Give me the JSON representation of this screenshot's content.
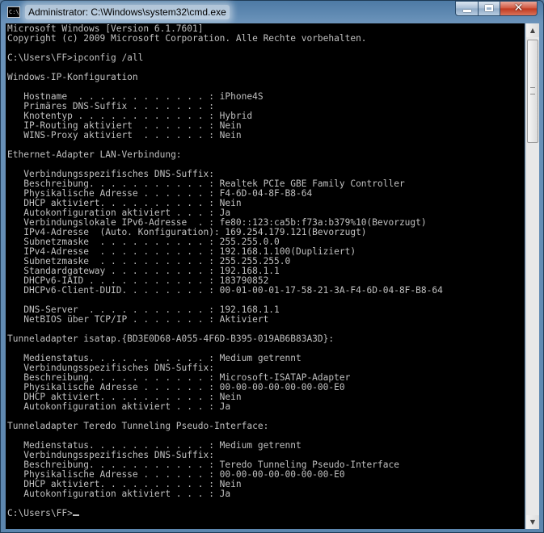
{
  "window": {
    "title": "Administrator: C:\\Windows\\system32\\cmd.exe",
    "icon": "cmd-icon",
    "icon_text": "C:\\",
    "controls": {
      "minimize": "minimize-icon",
      "maximize": "maximize-icon",
      "close": "✕"
    }
  },
  "console": {
    "text_color": "#c0c0c0",
    "background": "#000000",
    "lines": [
      "Microsoft Windows [Version 6.1.7601]",
      "Copyright (c) 2009 Microsoft Corporation. Alle Rechte vorbehalten.",
      "",
      "C:\\Users\\FF>ipconfig /all",
      "",
      "Windows-IP-Konfiguration",
      "",
      "   Hostname  . . . . . . . . . . . . : iPhone4S",
      "   Primäres DNS-Suffix . . . . . . . :",
      "   Knotentyp . . . . . . . . . . . . : Hybrid",
      "   IP-Routing aktiviert  . . . . . . : Nein",
      "   WINS-Proxy aktiviert  . . . . . . : Nein",
      "",
      "Ethernet-Adapter LAN-Verbindung:",
      "",
      "   Verbindungsspezifisches DNS-Suffix:",
      "   Beschreibung. . . . . . . . . . . : Realtek PCIe GBE Family Controller",
      "   Physikalische Adresse . . . . . . : F4-6D-04-8F-B8-64",
      "   DHCP aktiviert. . . . . . . . . . : Nein",
      "   Autokonfiguration aktiviert . . . : Ja",
      "   Verbindungslokale IPv6-Adresse  . : fe80::123:ca5b:f73a:b379%10(Bevorzugt)",
      "   IPv4-Adresse  (Auto. Konfiguration): 169.254.179.121(Bevorzugt)",
      "   Subnetzmaske  . . . . . . . . . . : 255.255.0.0",
      "   IPv4-Adresse  . . . . . . . . . . : 192.168.1.100(Dupliziert)",
      "   Subnetzmaske  . . . . . . . . . . : 255.255.255.0",
      "   Standardgateway . . . . . . . . . : 192.168.1.1",
      "   DHCPv6-IAID . . . . . . . . . . . : 183790852",
      "   DHCPv6-Client-DUID. . . . . . . . : 00-01-00-01-17-58-21-3A-F4-6D-04-8F-B8-64",
      "",
      "   DNS-Server  . . . . . . . . . . . : 192.168.1.1",
      "   NetBIOS über TCP/IP . . . . . . . : Aktiviert",
      "",
      "Tunneladapter isatap.{BD3E0D68-A055-4F6D-B395-019AB6B83A3D}:",
      "",
      "   Medienstatus. . . . . . . . . . . : Medium getrennt",
      "   Verbindungsspezifisches DNS-Suffix:",
      "   Beschreibung. . . . . . . . . . . : Microsoft-ISATAP-Adapter",
      "   Physikalische Adresse . . . . . . : 00-00-00-00-00-00-00-E0",
      "   DHCP aktiviert. . . . . . . . . . : Nein",
      "   Autokonfiguration aktiviert . . . : Ja",
      "",
      "Tunneladapter Teredo Tunneling Pseudo-Interface:",
      "",
      "   Medienstatus. . . . . . . . . . . : Medium getrennt",
      "   Verbindungsspezifisches DNS-Suffix:",
      "   Beschreibung. . . . . . . . . . . : Teredo Tunneling Pseudo-Interface",
      "   Physikalische Adresse . . . . . . : 00-00-00-00-00-00-00-E0",
      "   DHCP aktiviert. . . . . . . . . . : Nein",
      "   Autokonfiguration aktiviert . . . : Ja",
      "",
      "C:\\Users\\FF>"
    ]
  },
  "scrollbar": {
    "up_icon": "▲",
    "down_icon": "▼"
  }
}
